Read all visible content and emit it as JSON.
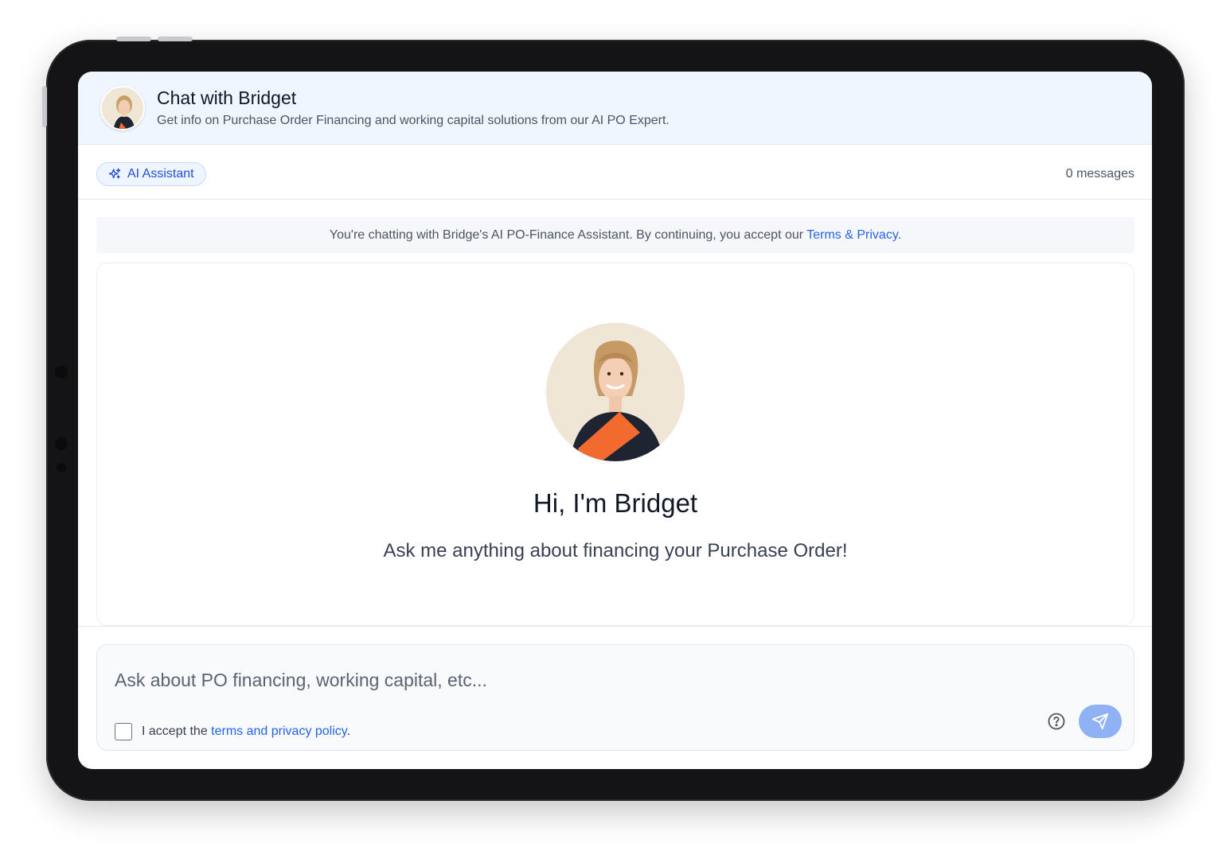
{
  "header": {
    "title": "Chat with Bridget",
    "subtitle": "Get info on Purchase Order Financing and working capital solutions from our AI PO Expert."
  },
  "toolbar": {
    "badge_label": "AI Assistant",
    "badge_icon": "sparkles-icon",
    "message_count": "0 messages"
  },
  "notice": {
    "text": "You're chatting with Bridge's AI PO-Finance Assistant. By continuing, you accept our ",
    "link_text": "Terms & Privacy",
    "suffix": "."
  },
  "welcome": {
    "title": "Hi, I'm Bridget",
    "subtitle": "Ask me anything about financing your Purchase Order!"
  },
  "composer": {
    "placeholder": "Ask about PO financing, working capital, etc...",
    "value": "",
    "accept_prefix": "I accept the ",
    "accept_link": "terms and privacy policy",
    "accept_suffix": ".",
    "accept_checked": false,
    "help_icon": "question-circle-icon",
    "send_icon": "send-icon"
  },
  "colors": {
    "accent": "#2563eb",
    "header_bg": "#f0f6ff",
    "send_button": "#8fb2f5",
    "avatar_accent": "#f26a2e"
  }
}
